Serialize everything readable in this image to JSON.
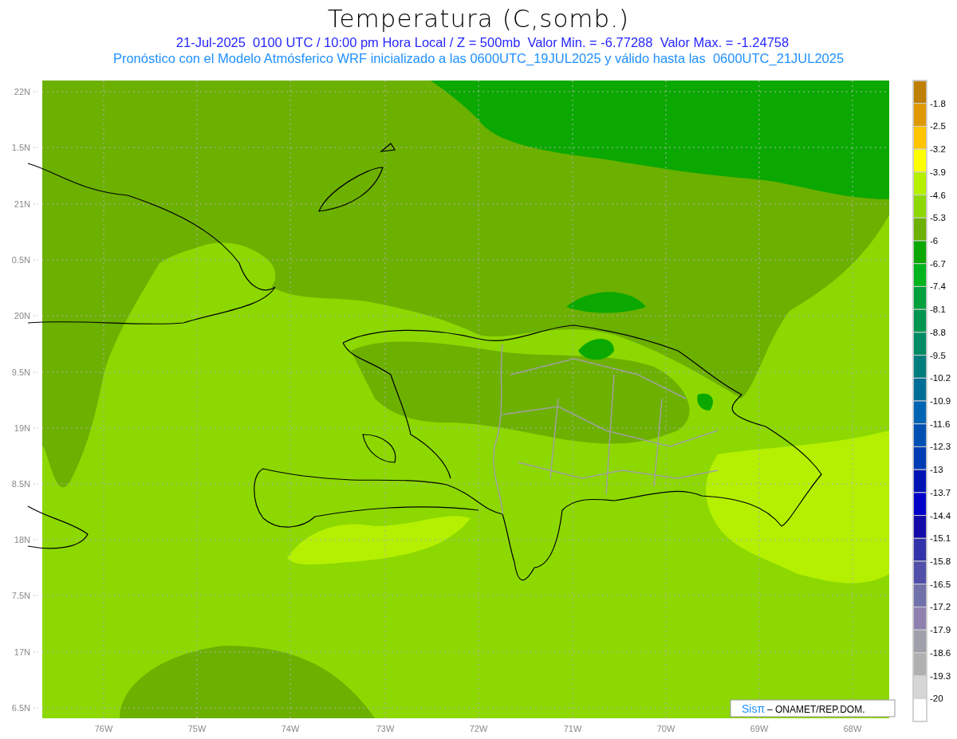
{
  "title": "Temperatura (C,somb.)",
  "subtitle": "21-Jul-2025  0100 UTC / 10:00 pm Hora Local / Z = 500mb  Valor Min. = -6.77288  Valor Max. = -1.24758",
  "forecast_note": "Pronóstico con el Modelo Atmósferico WRF inicializado a las 0600UTC_19JUL2025 y válido hasta las  0600UTC_21JUL2025",
  "map": {
    "lat_labels": [
      "22N",
      "1.5N",
      "21N",
      "0.5N",
      "20N",
      "9.5N",
      "19N",
      "8.5N",
      "18N",
      "7.5N",
      "17N",
      "6.5N"
    ],
    "lon_labels": [
      "76W",
      "75W",
      "74W",
      "73W",
      "72W",
      "71W",
      "70W",
      "69W",
      "68W"
    ],
    "credit": {
      "mark": "Sisπ",
      "text": "– ONAMET/REP.DOM."
    }
  },
  "legend": {
    "boxes": [
      {
        "color": "#bf7f00"
      },
      {
        "color": "#df9800"
      },
      {
        "color": "#ffc400"
      },
      {
        "color": "#ffff00"
      },
      {
        "color": "#b4f000"
      },
      {
        "color": "#8cd800"
      },
      {
        "color": "#6cb000"
      },
      {
        "color": "#0aa800"
      },
      {
        "color": "#00b41e"
      },
      {
        "color": "#00a03c"
      },
      {
        "color": "#009650"
      },
      {
        "color": "#008c64"
      },
      {
        "color": "#007d7d"
      },
      {
        "color": "#006e96"
      },
      {
        "color": "#0064b4"
      },
      {
        "color": "#0050b4"
      },
      {
        "color": "#003cb4"
      },
      {
        "color": "#0014b4"
      },
      {
        "color": "#0000c8"
      },
      {
        "color": "#140aaa"
      },
      {
        "color": "#3232aa"
      },
      {
        "color": "#5050aa"
      },
      {
        "color": "#7070aa"
      },
      {
        "color": "#9080b0"
      },
      {
        "color": "#a0a0aa"
      },
      {
        "color": "#b0b0b0"
      },
      {
        "color": "#d6d6d6"
      },
      {
        "color": "#ffffff"
      }
    ],
    "labels": [
      "-1.8",
      "-2.5",
      "-3.2",
      "-3.9",
      "-4.6",
      "-5.3",
      "-6",
      "-6.7",
      "-7.4",
      "-8.1",
      "-8.8",
      "-9.5",
      "-10.2",
      "-10.9",
      "-11.6",
      "-12.3",
      "-13",
      "-13.7",
      "-14.4",
      "-15.1",
      "-15.8",
      "-16.5",
      "-17.2",
      "-17.9",
      "-18.6",
      "-19.3",
      "-20"
    ]
  }
}
